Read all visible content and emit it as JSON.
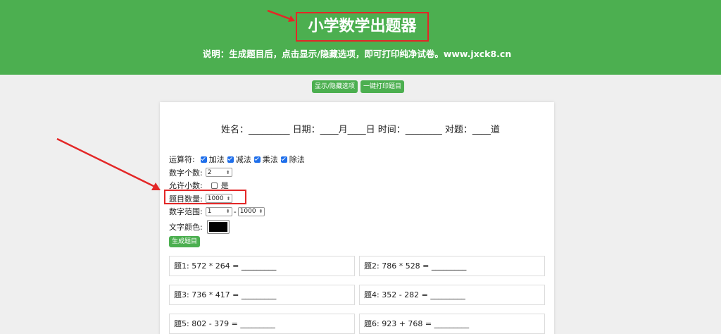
{
  "header": {
    "title": "小学数学出题器",
    "subtitle": "说明：生成题目后，点击显示/隐藏选项，即可打印纯净试卷。www.jxck8.cn"
  },
  "actions": {
    "toggle_label": "显示/隐藏选项",
    "print_label": "一键打印题目"
  },
  "info_line": "姓名：_________ 日期：____月____日 时间：________ 对题：____道",
  "settings": {
    "operators_label": "运算符:",
    "operators": [
      {
        "label": "加法",
        "checked": true
      },
      {
        "label": "减法",
        "checked": true
      },
      {
        "label": "乘法",
        "checked": true
      },
      {
        "label": "除法",
        "checked": true
      }
    ],
    "digit_count_label": "数字个数:",
    "digit_count": "2",
    "allow_decimal_label": "允许小数:",
    "allow_decimal_option": "是",
    "allow_decimal_checked": false,
    "question_count_label": "题目数量:",
    "question_count": "1000",
    "range_label": "数字范围:",
    "range_min": "1",
    "range_separator": "-",
    "range_max": "1000",
    "text_color_label": "文字颜色:",
    "text_color": "#000000",
    "generate_label": "生成题目"
  },
  "questions": [
    "题1:  572 * 264 = _________",
    "题2:  786 * 528 = _________",
    "题3:  736 * 417 = _________",
    "题4:  352 - 282 = _________",
    "题5:  802 - 379 = _________",
    "题6:  923 + 768 = _________"
  ],
  "annotation_color": "#e32727"
}
